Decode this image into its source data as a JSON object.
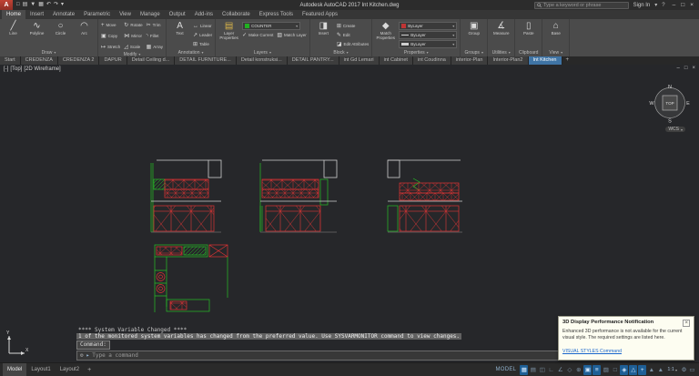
{
  "titlebar": {
    "app_label": "A",
    "qat_icons": [
      {
        "name": "new-file-icon",
        "glyph": "□"
      },
      {
        "name": "open-file-icon",
        "glyph": "▤"
      },
      {
        "name": "save-icon",
        "glyph": "▼"
      },
      {
        "name": "plot-icon",
        "glyph": "▦"
      },
      {
        "name": "undo-icon",
        "glyph": "↶"
      },
      {
        "name": "redo-icon",
        "glyph": "↷"
      },
      {
        "name": "qat-dropdown-icon",
        "glyph": "▾"
      }
    ],
    "title": "Autodesk AutoCAD 2017   Int Kitchen.dwg",
    "search": {
      "placeholder": "Type a keyword or phrase"
    },
    "signin_label": "Sign In",
    "signin_caret": "▾",
    "help_icon": "?",
    "window_controls": {
      "minimize": "–",
      "maximize": "□",
      "close": "×"
    }
  },
  "ribbon": {
    "tabs": [
      {
        "label": "Home",
        "active": true
      },
      {
        "label": "Insert"
      },
      {
        "label": "Annotate"
      },
      {
        "label": "Parametric"
      },
      {
        "label": "View"
      },
      {
        "label": "Manage"
      },
      {
        "label": "Output"
      },
      {
        "label": "Add-ins"
      },
      {
        "label": "Collaborate"
      },
      {
        "label": "Express Tools"
      },
      {
        "label": "Featured Apps"
      }
    ],
    "draw": {
      "label": "Draw",
      "buttons": [
        {
          "name": "line-button",
          "glyph": "╱",
          "label": "Line"
        },
        {
          "name": "polyline-button",
          "glyph": "∿",
          "label": "Polyline"
        },
        {
          "name": "circle-button",
          "glyph": "○",
          "label": "Circle"
        },
        {
          "name": "arc-button",
          "glyph": "◠",
          "label": "Arc"
        }
      ]
    },
    "modify": {
      "label": "Modify",
      "buttons": [
        {
          "name": "move-button",
          "glyph": "+",
          "label": "Move"
        },
        {
          "name": "copy-button",
          "glyph": "▣",
          "label": "Copy"
        },
        {
          "name": "stretch-button",
          "glyph": "↦",
          "label": "Stretch"
        },
        {
          "name": "rotate-button",
          "glyph": "↻",
          "label": "Rotate"
        },
        {
          "name": "mirror-button",
          "glyph": "⋈",
          "label": "Mirror"
        },
        {
          "name": "scale-button",
          "glyph": "◿",
          "label": "Scale"
        },
        {
          "name": "trim-button",
          "glyph": "✂",
          "label": "Trim"
        },
        {
          "name": "fillet-button",
          "glyph": "◝",
          "label": "Fillet"
        },
        {
          "name": "array-button",
          "glyph": "▦",
          "label": "Array"
        }
      ]
    },
    "annotation": {
      "label": "Annotation",
      "big": {
        "glyph": "A",
        "label": "Text"
      },
      "items": [
        {
          "name": "linear-dimension-button",
          "glyph": "↔",
          "label": "Linear"
        },
        {
          "name": "leader-button",
          "glyph": "↗",
          "label": "Leader"
        },
        {
          "name": "table-button",
          "glyph": "⊞",
          "label": "Table"
        }
      ]
    },
    "layers": {
      "label": "Layers",
      "big": {
        "glyph": "▤",
        "label": "Layer Properties"
      },
      "combo_value": "COUNTER",
      "items": [
        {
          "name": "make-current-button",
          "glyph": "✓",
          "label": "Make Current"
        },
        {
          "name": "match-layer-button",
          "glyph": "▧",
          "label": "Match Layer"
        }
      ]
    },
    "block": {
      "label": "Block",
      "big": {
        "glyph": "◨",
        "label": "Insert"
      },
      "items": [
        {
          "name": "create-block-button",
          "glyph": "⊞",
          "label": "Create"
        },
        {
          "name": "edit-block-button",
          "glyph": "✎",
          "label": "Edit"
        },
        {
          "name": "edit-attributes-button",
          "glyph": "◪",
          "label": "Edit Attributes"
        }
      ]
    },
    "properties": {
      "label": "Properties",
      "big": {
        "glyph": "◆",
        "label": "Match Properties"
      },
      "combos": [
        {
          "value": "ByLayer"
        },
        {
          "value": "ByLayer"
        },
        {
          "value": "ByLayer"
        }
      ]
    },
    "groups": {
      "label": "Groups",
      "big": {
        "glyph": "▣",
        "label": "Group"
      }
    },
    "utilities": {
      "label": "Utilities",
      "big": {
        "glyph": "∡",
        "label": "Measure"
      }
    },
    "clipboard": {
      "label": "Clipboard",
      "big": {
        "glyph": "▯",
        "label": "Paste"
      }
    },
    "view": {
      "label": "View",
      "big": {
        "glyph": "⌂",
        "label": "Base"
      }
    }
  },
  "file_tabs": [
    {
      "label": "Start"
    },
    {
      "label": "CREDENZA"
    },
    {
      "label": "CREDENZA 2"
    },
    {
      "label": "DAPUR"
    },
    {
      "label": "Detail Ceiling d..."
    },
    {
      "label": "DETAIL FURNITURE..."
    },
    {
      "label": "Detail konstruksi..."
    },
    {
      "label": "DETAIL PANTRY..."
    },
    {
      "label": "int Gd Lemari"
    },
    {
      "label": "int Cabinet"
    },
    {
      "label": "int Coudinna"
    },
    {
      "label": "interior-Plan"
    },
    {
      "label": "Interior-Plan2"
    },
    {
      "label": "Int Kitchen",
      "active": true
    }
  ],
  "file_tabs_add": "+",
  "viewport": {
    "controls": [
      "[-]",
      "[Top]",
      "[2D Wireframe]"
    ],
    "viewcube": {
      "n": "N",
      "s": "S",
      "e": "E",
      "w": "W",
      "face": "TOP"
    },
    "wcs": "WCS",
    "wcs_caret": "▾",
    "doc_controls": {
      "minimize": "–",
      "restore": "□",
      "close": "×"
    }
  },
  "command": {
    "history": [
      {
        "text": "**** System Variable Changed ****",
        "highlight": false
      },
      {
        "text": "1 of the monitored system variables has changed from the preferred value.  Use SYSVARMONITOR command to view changes.",
        "highlight": true
      }
    ],
    "prompt": "Command:",
    "customize_icon": "⚙",
    "input_icon": "▸",
    "input_placeholder": "Type a command"
  },
  "statusbar": {
    "layout_tabs": [
      {
        "label": "Model",
        "active": true
      },
      {
        "label": "Layout1"
      },
      {
        "label": "Layout2"
      }
    ],
    "add_layout": "+",
    "mode_label": "MODEL",
    "icons": [
      {
        "name": "grid-icon",
        "glyph": "▦",
        "active": true
      },
      {
        "name": "snap-icon",
        "glyph": "▤",
        "active": false
      },
      {
        "name": "infer-constraints-icon",
        "glyph": "◫",
        "active": false
      },
      {
        "name": "ortho-icon",
        "glyph": "∟",
        "active": false
      },
      {
        "name": "polar-tracking-icon",
        "glyph": "∠",
        "active": false
      },
      {
        "name": "isodraft-icon",
        "glyph": "◇",
        "active": false
      },
      {
        "name": "osnap-tracking-icon",
        "glyph": "⊕",
        "active": false
      },
      {
        "name": "osnap-icon",
        "glyph": "▣",
        "active": true
      },
      {
        "name": "lineweight-icon",
        "glyph": "≡",
        "active": true
      },
      {
        "name": "transparency-icon",
        "glyph": "▨",
        "active": false
      },
      {
        "name": "selection-cycling-icon",
        "glyph": "□",
        "active": false
      },
      {
        "name": "osnap-3d-icon",
        "glyph": "◈",
        "active": true
      },
      {
        "name": "dynamic-ucs-icon",
        "glyph": "△",
        "active": true
      },
      {
        "name": "dynamic-input-icon",
        "glyph": "+",
        "active": true
      },
      {
        "name": "annotation-visibility-icon",
        "glyph": "▲",
        "active": false
      },
      {
        "name": "annotation-autoscale-icon",
        "glyph": "▲",
        "active": false
      }
    ],
    "annotation_scale": "1:1",
    "scale_caret": "▾",
    "gear_icon": "⚙",
    "clean_screen_icon": "▭"
  },
  "notification": {
    "title": "3D Display Performance Notification",
    "body_line1": "Enhanced 3D performance is not available for the current visual style.",
    "body_line2": "The required settings are listed here.",
    "link": "VISUAL STYLES Command",
    "close": "×"
  }
}
